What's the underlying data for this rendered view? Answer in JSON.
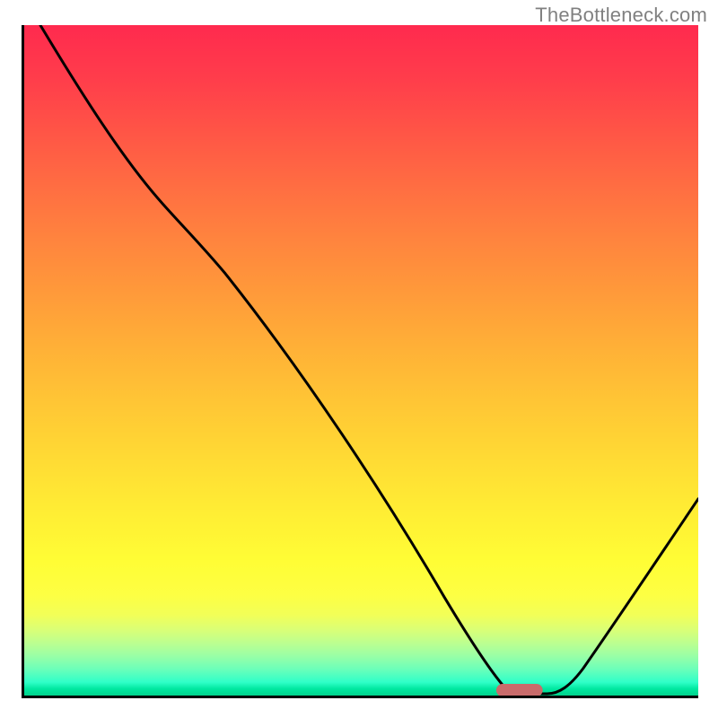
{
  "watermark": "TheBottleneck.com",
  "chart_data": {
    "type": "line",
    "title": "",
    "xlabel": "",
    "ylabel": "",
    "x": [
      0,
      5,
      10,
      15,
      20,
      22,
      25,
      30,
      35,
      40,
      45,
      50,
      55,
      60,
      65,
      68,
      70,
      72,
      74,
      76,
      78,
      80,
      85,
      90,
      95,
      100
    ],
    "values": [
      100,
      94,
      88,
      82,
      76,
      74,
      69,
      60,
      51,
      43,
      34,
      26,
      18,
      11,
      5,
      2,
      1,
      0,
      0,
      0,
      1,
      3,
      8,
      15,
      22,
      30
    ],
    "xlim": [
      0,
      100
    ],
    "ylim": [
      0,
      100
    ],
    "background_gradient": {
      "top": "#ff2a4e",
      "mid": "#ffe533",
      "bottom": "#00d38c"
    },
    "marker": {
      "shape": "rounded-rect",
      "x_center": 73,
      "y": 0,
      "color": "#c96b6b"
    },
    "axis_color": "#000000",
    "curve_color": "#000000"
  }
}
